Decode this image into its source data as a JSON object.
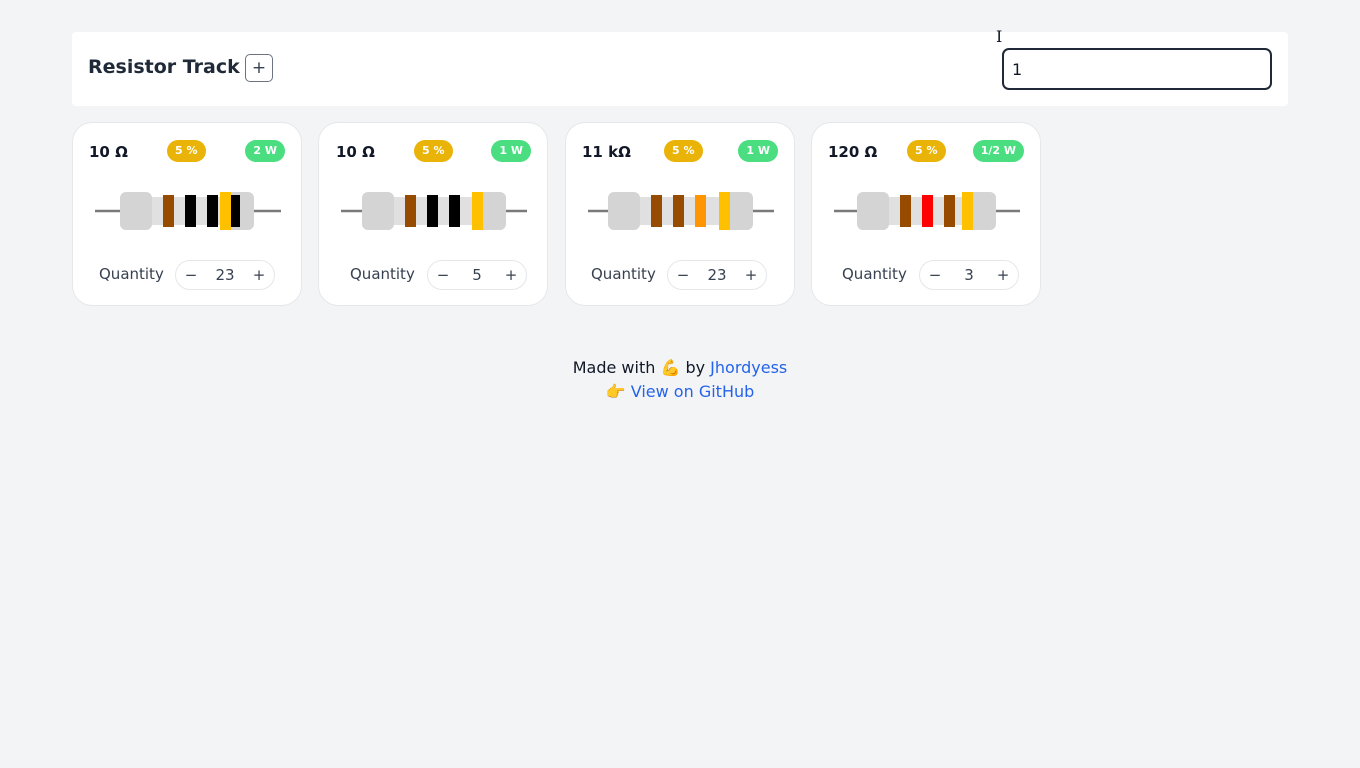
{
  "app": {
    "title": "Resistor Track",
    "add_label": "+",
    "search_value": "1"
  },
  "cards": [
    {
      "resistance": "10 Ω",
      "tolerance": "5 %",
      "power": "2 W",
      "quantity_label": "Quantity",
      "quantity": "23",
      "bands": [
        "#964B00",
        "#000000",
        "#000000",
        "#000000",
        "#FFC000"
      ]
    },
    {
      "resistance": "10 Ω",
      "tolerance": "5 %",
      "power": "1 W",
      "quantity_label": "Quantity",
      "quantity": "5",
      "bands": [
        "#964B00",
        "#000000",
        "#000000",
        "#FFC000"
      ]
    },
    {
      "resistance": "11 kΩ",
      "tolerance": "5 %",
      "power": "1 W",
      "quantity_label": "Quantity",
      "quantity": "23",
      "bands": [
        "#964B00",
        "#964B00",
        "#FF9500",
        "#FFC000"
      ]
    },
    {
      "resistance": "120 Ω",
      "tolerance": "5 %",
      "power": "1/2 W",
      "quantity_label": "Quantity",
      "quantity": "3",
      "bands": [
        "#964B00",
        "#FF0000",
        "#964B00",
        "#FFC000"
      ]
    }
  ],
  "stepper": {
    "minus_label": "−",
    "plus_label": "+"
  },
  "footer": {
    "made_with": "Made with 💪 by",
    "author": "Jhordyess",
    "pointer": "👉",
    "github_link": "View on GitHub"
  }
}
